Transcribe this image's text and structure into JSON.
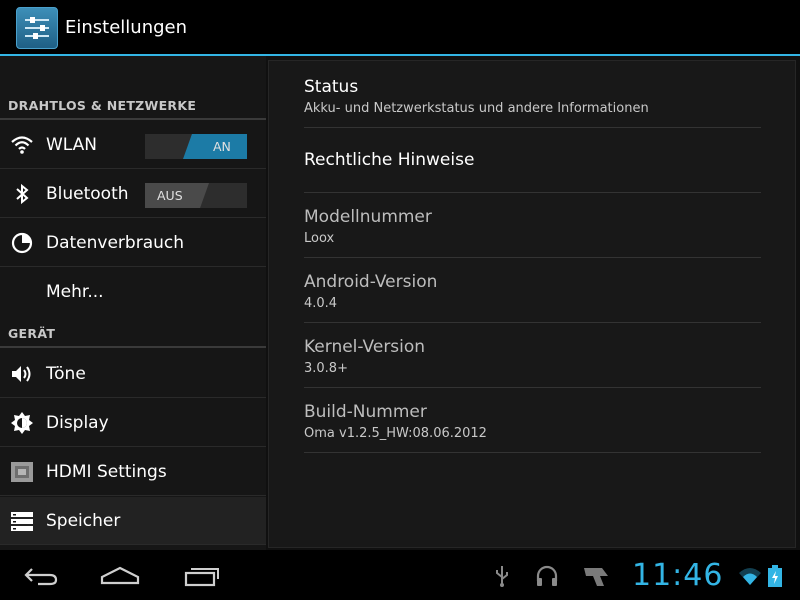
{
  "header": {
    "title": "Einstellungen"
  },
  "sidebar": {
    "sections": [
      {
        "header": "DRAHTLOS & NETZWERKE"
      },
      {
        "header": "GERÄT"
      }
    ],
    "items": [
      {
        "label": "WLAN",
        "icon": "wifi-icon",
        "toggle": "AN",
        "toggle_on": true
      },
      {
        "label": "Bluetooth",
        "icon": "bluetooth-icon",
        "toggle": "AUS",
        "toggle_on": false
      },
      {
        "label": "Datenverbrauch",
        "icon": "data-usage-icon"
      },
      {
        "label": "Mehr...",
        "icon": ""
      },
      {
        "label": "Töne",
        "icon": "speaker-icon"
      },
      {
        "label": "Display",
        "icon": "brightness-icon"
      },
      {
        "label": "HDMI Settings",
        "icon": "hdmi-icon"
      },
      {
        "label": "Speicher",
        "icon": "storage-icon"
      }
    ]
  },
  "detail": {
    "rows": [
      {
        "title": "Status",
        "subtitle": "Akku- und Netzwerkstatus und andere Informationen"
      },
      {
        "title": "Rechtliche Hinweise",
        "subtitle": ""
      },
      {
        "title": "Modellnummer",
        "subtitle": "Loox"
      },
      {
        "title": "Android-Version",
        "subtitle": "4.0.4"
      },
      {
        "title": "Kernel-Version",
        "subtitle": "3.0.8+"
      },
      {
        "title": "Build-Nummer",
        "subtitle": "Oma v1.2.5_HW:08.06.2012"
      }
    ]
  },
  "statusbar": {
    "time": "11:46",
    "accent": "#33b5e5"
  }
}
